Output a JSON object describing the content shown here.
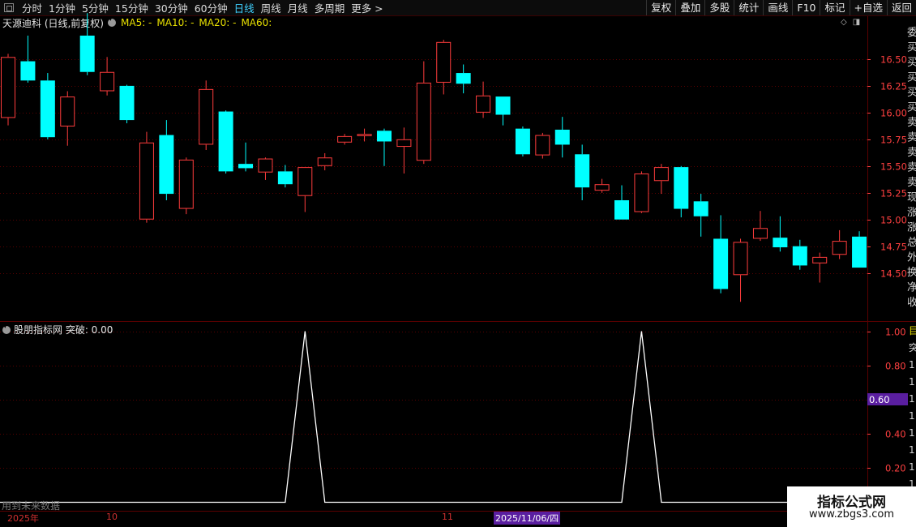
{
  "toolbar": {
    "periods": [
      "分时",
      "1分钟",
      "5分钟",
      "15分钟",
      "30分钟",
      "60分钟",
      "日线",
      "周线",
      "月线",
      "多周期",
      "更多 >"
    ],
    "active_period": "日线",
    "buttons": [
      "复权",
      "叠加",
      "多股",
      "统计",
      "画线",
      "F10",
      "标记",
      "+自选",
      "返回"
    ]
  },
  "main_header": {
    "stock_label": "天源迪科 (日线,前复权)",
    "ma5": "MA5: -",
    "ma10": "MA10: -",
    "ma20": "MA20: -",
    "ma60": "MA60:"
  },
  "indicator_header": {
    "label": "股朋指标网 突破: 0.00"
  },
  "warning_text": "用到未来数据",
  "date_axis": {
    "labels": [
      "2025年",
      "10",
      "11"
    ],
    "current_date": "2025/11/06/四"
  },
  "right_strip_text": [
    "委",
    "买",
    "买",
    "买",
    "买",
    "买",
    "卖",
    "卖",
    "卖",
    "卖",
    "卖",
    "现",
    "涨",
    "涨",
    "总",
    "外",
    "换",
    "净",
    "收"
  ],
  "sub_right_strip_text": [
    "目",
    "突",
    "1",
    "1",
    "1",
    "1",
    "1",
    "1",
    "1",
    "1"
  ],
  "watermark": {
    "line1": "指标公式网",
    "line2": "www.zbgs3.com"
  },
  "colors": {
    "up": "#ff3c3c",
    "down": "#00ffff",
    "grid": "#5a0000",
    "axis_text": "#ff4040",
    "line": "#ffffff",
    "tag": "#5a1ea0"
  },
  "chart_data": [
    {
      "type": "candlestick",
      "title": "天源迪科 (日线,前复权)",
      "y_ticks": [
        14.5,
        14.75,
        15.0,
        15.25,
        15.5,
        15.75,
        16.0,
        16.25,
        16.5
      ],
      "ylim": [
        14.05,
        16.78
      ],
      "candles": [
        {
          "o": 15.95,
          "c": 16.52,
          "h": 16.55,
          "l": 15.88
        },
        {
          "o": 16.48,
          "c": 16.3,
          "h": 16.72,
          "l": 16.28
        },
        {
          "o": 16.3,
          "c": 15.77,
          "h": 16.37,
          "l": 15.75
        },
        {
          "o": 15.87,
          "c": 16.15,
          "h": 16.2,
          "l": 15.69
        },
        {
          "o": 16.72,
          "c": 16.38,
          "h": 16.93,
          "l": 16.35
        },
        {
          "o": 16.2,
          "c": 16.38,
          "h": 16.52,
          "l": 16.16
        },
        {
          "o": 16.25,
          "c": 15.93,
          "h": 16.26,
          "l": 15.9
        },
        {
          "o": 15.0,
          "c": 15.72,
          "h": 15.82,
          "l": 14.97
        },
        {
          "o": 15.79,
          "c": 15.24,
          "h": 15.93,
          "l": 15.18
        },
        {
          "o": 15.1,
          "c": 15.56,
          "h": 15.58,
          "l": 15.05
        },
        {
          "o": 15.7,
          "c": 16.22,
          "h": 16.3,
          "l": 15.65
        },
        {
          "o": 16.01,
          "c": 15.45,
          "h": 16.02,
          "l": 15.43
        },
        {
          "o": 15.52,
          "c": 15.48,
          "h": 15.72,
          "l": 15.45
        },
        {
          "o": 15.44,
          "c": 15.57,
          "h": 15.58,
          "l": 15.37
        },
        {
          "o": 15.45,
          "c": 15.33,
          "h": 15.51,
          "l": 15.3
        },
        {
          "o": 15.22,
          "c": 15.49,
          "h": 15.49,
          "l": 15.07
        },
        {
          "o": 15.5,
          "c": 15.58,
          "h": 15.62,
          "l": 15.46
        },
        {
          "o": 15.72,
          "c": 15.78,
          "h": 15.8,
          "l": 15.7
        },
        {
          "o": 15.78,
          "c": 15.8,
          "h": 15.85,
          "l": 15.73
        },
        {
          "o": 15.83,
          "c": 15.73,
          "h": 15.85,
          "l": 15.5
        },
        {
          "o": 15.68,
          "c": 15.75,
          "h": 15.86,
          "l": 15.43
        },
        {
          "o": 15.55,
          "c": 16.28,
          "h": 16.48,
          "l": 15.52
        },
        {
          "o": 16.28,
          "c": 16.66,
          "h": 16.68,
          "l": 16.17
        },
        {
          "o": 16.37,
          "c": 16.27,
          "h": 16.45,
          "l": 16.18
        },
        {
          "o": 16.0,
          "c": 16.16,
          "h": 16.29,
          "l": 15.95
        },
        {
          "o": 16.15,
          "c": 15.98,
          "h": 16.15,
          "l": 15.88
        },
        {
          "o": 15.85,
          "c": 15.61,
          "h": 15.87,
          "l": 15.59
        },
        {
          "o": 15.6,
          "c": 15.79,
          "h": 15.81,
          "l": 15.57
        },
        {
          "o": 15.84,
          "c": 15.7,
          "h": 15.96,
          "l": 15.58
        },
        {
          "o": 15.61,
          "c": 15.3,
          "h": 15.7,
          "l": 15.18
        },
        {
          "o": 15.27,
          "c": 15.33,
          "h": 15.38,
          "l": 15.25
        },
        {
          "o": 15.18,
          "c": 15.0,
          "h": 15.32,
          "l": 15.0
        },
        {
          "o": 15.07,
          "c": 15.43,
          "h": 15.45,
          "l": 15.06
        },
        {
          "o": 15.36,
          "c": 15.49,
          "h": 15.52,
          "l": 15.24
        },
        {
          "o": 15.49,
          "c": 15.1,
          "h": 15.5,
          "l": 15.02
        },
        {
          "o": 15.17,
          "c": 15.03,
          "h": 15.24,
          "l": 14.84
        },
        {
          "o": 14.82,
          "c": 14.35,
          "h": 15.04,
          "l": 14.31
        },
        {
          "o": 14.48,
          "c": 14.79,
          "h": 14.82,
          "l": 14.23
        },
        {
          "o": 14.82,
          "c": 14.92,
          "h": 15.08,
          "l": 14.8
        },
        {
          "o": 14.83,
          "c": 14.74,
          "h": 15.03,
          "l": 14.7
        },
        {
          "o": 14.75,
          "c": 14.57,
          "h": 14.81,
          "l": 14.53
        },
        {
          "o": 14.59,
          "c": 14.65,
          "h": 14.69,
          "l": 14.41
        },
        {
          "o": 14.67,
          "c": 14.8,
          "h": 14.9,
          "l": 14.63
        },
        {
          "o": 14.84,
          "c": 14.55,
          "h": 14.89,
          "l": 14.55
        }
      ]
    },
    {
      "type": "line",
      "title": "股朋指标网 突破",
      "y_ticks": [
        0.2,
        0.4,
        0.6,
        0.8,
        1.0
      ],
      "ylim": [
        -0.05,
        1.06
      ],
      "marker_value": "0.60",
      "series": [
        {
          "values": [
            0,
            0,
            0,
            0,
            0,
            0,
            0,
            0,
            0,
            0,
            0,
            0,
            0,
            0,
            0,
            1,
            0,
            0,
            0,
            0,
            0,
            0,
            0,
            0,
            0,
            0,
            0,
            0,
            0,
            0,
            0,
            0,
            1,
            0,
            0,
            0,
            0,
            0,
            0,
            0,
            0,
            0,
            0,
            0
          ]
        }
      ]
    }
  ]
}
